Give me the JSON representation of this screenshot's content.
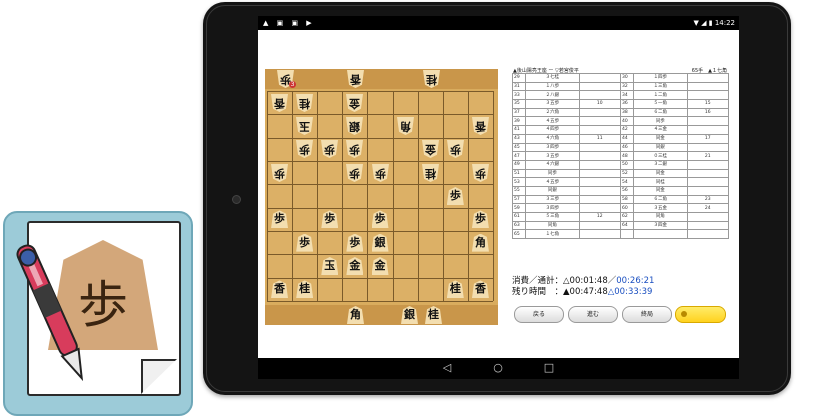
{
  "statusbar": {
    "left_icons": "▲ ▣ ▣ ▶",
    "right": "▼ ◢ ▮ 14:22"
  },
  "record": {
    "title": "▲後山陽亮王座 ー ▽若宮俊平",
    "move_count": "65手　▲１七角",
    "rows": [
      {
        "n1": "29",
        "m1": "３七桂",
        "t1": "",
        "n2": "30",
        "m2": "１四歩",
        "t2": ""
      },
      {
        "n1": "31",
        "m1": "１八歩",
        "t1": "",
        "n2": "32",
        "m2": "１三角",
        "t2": ""
      },
      {
        "n1": "33",
        "m1": "２八銀",
        "t1": "",
        "n2": "34",
        "m2": "１二角",
        "t2": ""
      },
      {
        "n1": "35",
        "m1": "３五歩",
        "t1": "10",
        "n2": "36",
        "m2": "５一角",
        "t2": "15"
      },
      {
        "n1": "37",
        "m1": "２六角",
        "t1": "",
        "n2": "38",
        "m2": "６二角",
        "t2": "16"
      },
      {
        "n1": "39",
        "m1": "４五歩",
        "t1": "",
        "n2": "40",
        "m2": "同歩",
        "t2": ""
      },
      {
        "n1": "41",
        "m1": "４四歩",
        "t1": "",
        "n2": "42",
        "m2": "４三金",
        "t2": ""
      },
      {
        "n1": "43",
        "m1": "４六角",
        "t1": "11",
        "n2": "44",
        "m2": "同金",
        "t2": "17"
      },
      {
        "n1": "45",
        "m1": "３四歩",
        "t1": "",
        "n2": "46",
        "m2": "同銀",
        "t2": ""
      },
      {
        "n1": "47",
        "m1": "３五歩",
        "t1": "",
        "n2": "48",
        "m2": "０三桂",
        "t2": "21"
      },
      {
        "n1": "49",
        "m1": "４六銀",
        "t1": "",
        "n2": "50",
        "m2": "３二銀",
        "t2": ""
      },
      {
        "n1": "51",
        "m1": "同歩",
        "t1": "",
        "n2": "52",
        "m2": "同金",
        "t2": ""
      },
      {
        "n1": "53",
        "m1": "４五歩",
        "t1": "",
        "n2": "54",
        "m2": "同桂",
        "t2": ""
      },
      {
        "n1": "55",
        "m1": "同銀",
        "t1": "",
        "n2": "56",
        "m2": "同金",
        "t2": ""
      },
      {
        "n1": "57",
        "m1": "３三歩",
        "t1": "",
        "n2": "58",
        "m2": "６二角",
        "t2": "23"
      },
      {
        "n1": "59",
        "m1": "３四歩",
        "t1": "",
        "n2": "60",
        "m2": "３五金",
        "t2": "24"
      },
      {
        "n1": "61",
        "m1": "５三角",
        "t1": "12",
        "n2": "62",
        "m2": "同角",
        "t2": ""
      },
      {
        "n1": "63",
        "m1": "同角",
        "t1": "",
        "n2": "64",
        "m2": "３四金",
        "t2": ""
      },
      {
        "n1": "65",
        "m1": "１七角",
        "t1": "",
        "n2": "",
        "m2": "",
        "t2": ""
      }
    ]
  },
  "clock": {
    "consumed_label": "消費／通計：",
    "consumed_black": "△00:01:48",
    "sep": "／",
    "consumed_total": "00:26:21",
    "remaining_label": "残り時間　：",
    "remaining_black": "▲00:47:48",
    "remaining_white": "△00:33:39"
  },
  "buttons": {
    "back": "戻る",
    "forward": "進む",
    "end": "終局",
    "extra": ""
  },
  "board": {
    "gote_hand": [
      "歩",
      "香",
      "桂"
    ],
    "gote_hand_count": "3",
    "sente_hand": [
      "角",
      "銀",
      "桂"
    ],
    "pieces": [
      {
        "ch": "香",
        "g": true,
        "f": 9,
        "r": 1
      },
      {
        "ch": "桂",
        "g": true,
        "f": 8,
        "r": 1
      },
      {
        "ch": "金",
        "g": true,
        "f": 6,
        "r": 1
      },
      {
        "ch": "玉",
        "g": true,
        "f": 8,
        "r": 2
      },
      {
        "ch": "銀",
        "g": true,
        "f": 6,
        "r": 2
      },
      {
        "ch": "角",
        "g": true,
        "f": 4,
        "r": 2
      },
      {
        "ch": "香",
        "g": true,
        "f": 1,
        "r": 2
      },
      {
        "ch": "歩",
        "g": true,
        "f": 8,
        "r": 3
      },
      {
        "ch": "歩",
        "g": true,
        "f": 7,
        "r": 3
      },
      {
        "ch": "歩",
        "g": true,
        "f": 6,
        "r": 3
      },
      {
        "ch": "金",
        "g": true,
        "f": 3,
        "r": 3
      },
      {
        "ch": "歩",
        "g": true,
        "f": 2,
        "r": 3
      },
      {
        "ch": "歩",
        "g": true,
        "f": 9,
        "r": 4
      },
      {
        "ch": "歩",
        "g": true,
        "f": 6,
        "r": 4
      },
      {
        "ch": "歩",
        "g": true,
        "f": 5,
        "r": 4
      },
      {
        "ch": "桂",
        "g": true,
        "f": 3,
        "r": 4
      },
      {
        "ch": "歩",
        "g": true,
        "f": 1,
        "r": 4
      },
      {
        "ch": "歩",
        "g": false,
        "f": 2,
        "r": 5
      },
      {
        "ch": "歩",
        "g": false,
        "f": 9,
        "r": 6
      },
      {
        "ch": "歩",
        "g": false,
        "f": 7,
        "r": 6
      },
      {
        "ch": "歩",
        "g": false,
        "f": 5,
        "r": 6
      },
      {
        "ch": "歩",
        "g": false,
        "f": 1,
        "r": 6
      },
      {
        "ch": "歩",
        "g": false,
        "f": 8,
        "r": 7
      },
      {
        "ch": "歩",
        "g": false,
        "f": 6,
        "r": 7
      },
      {
        "ch": "銀",
        "g": false,
        "f": 5,
        "r": 7
      },
      {
        "ch": "角",
        "g": false,
        "f": 1,
        "r": 7
      },
      {
        "ch": "玉",
        "g": false,
        "f": 7,
        "r": 8
      },
      {
        "ch": "金",
        "g": false,
        "f": 6,
        "r": 8
      },
      {
        "ch": "金",
        "g": false,
        "f": 5,
        "r": 8
      },
      {
        "ch": "香",
        "g": false,
        "f": 9,
        "r": 9
      },
      {
        "ch": "桂",
        "g": false,
        "f": 8,
        "r": 9
      },
      {
        "ch": "桂",
        "g": false,
        "f": 2,
        "r": 9
      },
      {
        "ch": "香",
        "g": false,
        "f": 1,
        "r": 9
      }
    ]
  },
  "icon": {
    "piece_char": "歩"
  },
  "nav": {
    "back": "◁",
    "home": "○",
    "recent": "□"
  }
}
